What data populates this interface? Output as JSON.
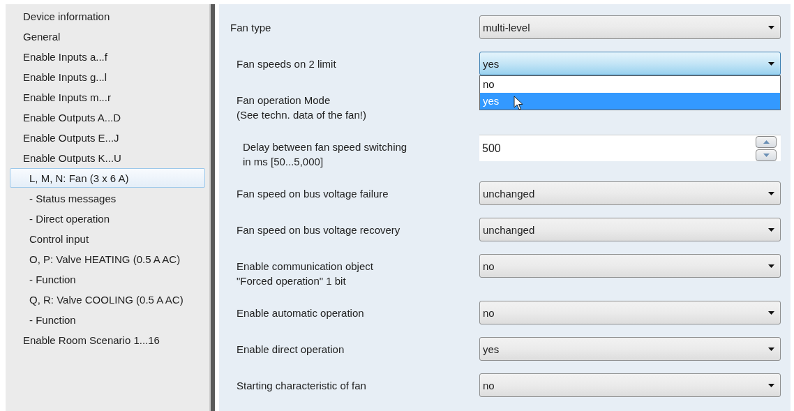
{
  "sidebar": {
    "items": [
      {
        "label": "Device information",
        "selected": false
      },
      {
        "label": "General",
        "selected": false
      },
      {
        "label": "Enable Inputs a...f",
        "selected": false
      },
      {
        "label": "Enable Inputs g...l",
        "selected": false
      },
      {
        "label": "Enable Inputs m...r",
        "selected": false
      },
      {
        "label": "Enable Outputs A...D",
        "selected": false
      },
      {
        "label": "Enable Outputs E...J",
        "selected": false
      },
      {
        "label": "Enable Outputs K...U",
        "selected": false,
        "children": [
          {
            "label": "L, M, N: Fan (3 x 6 A)",
            "selected": true
          },
          {
            "label": "- Status messages",
            "selected": false
          },
          {
            "label": "- Direct operation",
            "selected": false
          },
          {
            "label": "Control input",
            "selected": false
          },
          {
            "label": "O, P: Valve HEATING (0.5 A AC)",
            "selected": false
          },
          {
            "label": "- Function",
            "selected": false
          },
          {
            "label": "Q, R: Valve COOLING (0.5 A AC)",
            "selected": false
          },
          {
            "label": "- Function",
            "selected": false
          }
        ]
      },
      {
        "label": "Enable Room Scenario 1...16",
        "selected": false
      }
    ]
  },
  "parameters": [
    {
      "label": "Fan type",
      "control": {
        "kind": "dropdown",
        "value": "multi-level",
        "focused": false
      },
      "children": [
        {
          "label": "Fan speeds on 2 limit",
          "control": {
            "kind": "dropdown",
            "value": "yes",
            "focused": true,
            "options": [
              {
                "label": "no",
                "selected": false
              },
              {
                "label": "yes",
                "selected": true
              }
            ]
          }
        },
        {
          "label": "Fan operation Mode\n(See techn. data of the fan!)",
          "children": [
            {
              "label": "Delay between fan speed switching\nin ms [50...5,000]",
              "control": {
                "kind": "spinbox",
                "value": "500"
              }
            }
          ]
        },
        {
          "label": "Fan speed on bus voltage failure",
          "control": {
            "kind": "dropdown",
            "value": "unchanged",
            "focused": false
          }
        },
        {
          "label": "Fan speed on bus voltage recovery",
          "control": {
            "kind": "dropdown",
            "value": "unchanged",
            "focused": false
          }
        },
        {
          "label": "Enable communication object\n\"Forced operation\" 1 bit",
          "control": {
            "kind": "dropdown",
            "value": "no",
            "focused": false
          }
        },
        {
          "label": "Enable automatic operation",
          "control": {
            "kind": "dropdown",
            "value": "no",
            "focused": false
          }
        },
        {
          "label": "Enable direct operation",
          "control": {
            "kind": "dropdown",
            "value": "yes",
            "focused": false
          }
        },
        {
          "label": "Starting characteristic of fan",
          "control": {
            "kind": "dropdown",
            "value": "no",
            "focused": false
          }
        }
      ]
    }
  ]
}
